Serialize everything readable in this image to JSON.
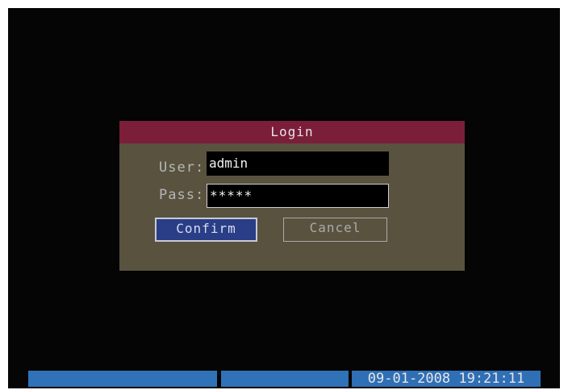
{
  "dialog": {
    "title": "Login",
    "user_label": "User:",
    "user_value": "admin",
    "pass_label": "Pass:",
    "pass_value": "*****",
    "confirm_label": "Confirm",
    "cancel_label": "Cancel"
  },
  "status_bar": {
    "datetime": "09-01-2008 19:21:11"
  },
  "colors": {
    "background": "#050505",
    "dialog_body": "#59523f",
    "dialog_title": "#7a1e3a",
    "confirm_button": "#2a3e87",
    "status_bar": "#2f72b8"
  }
}
